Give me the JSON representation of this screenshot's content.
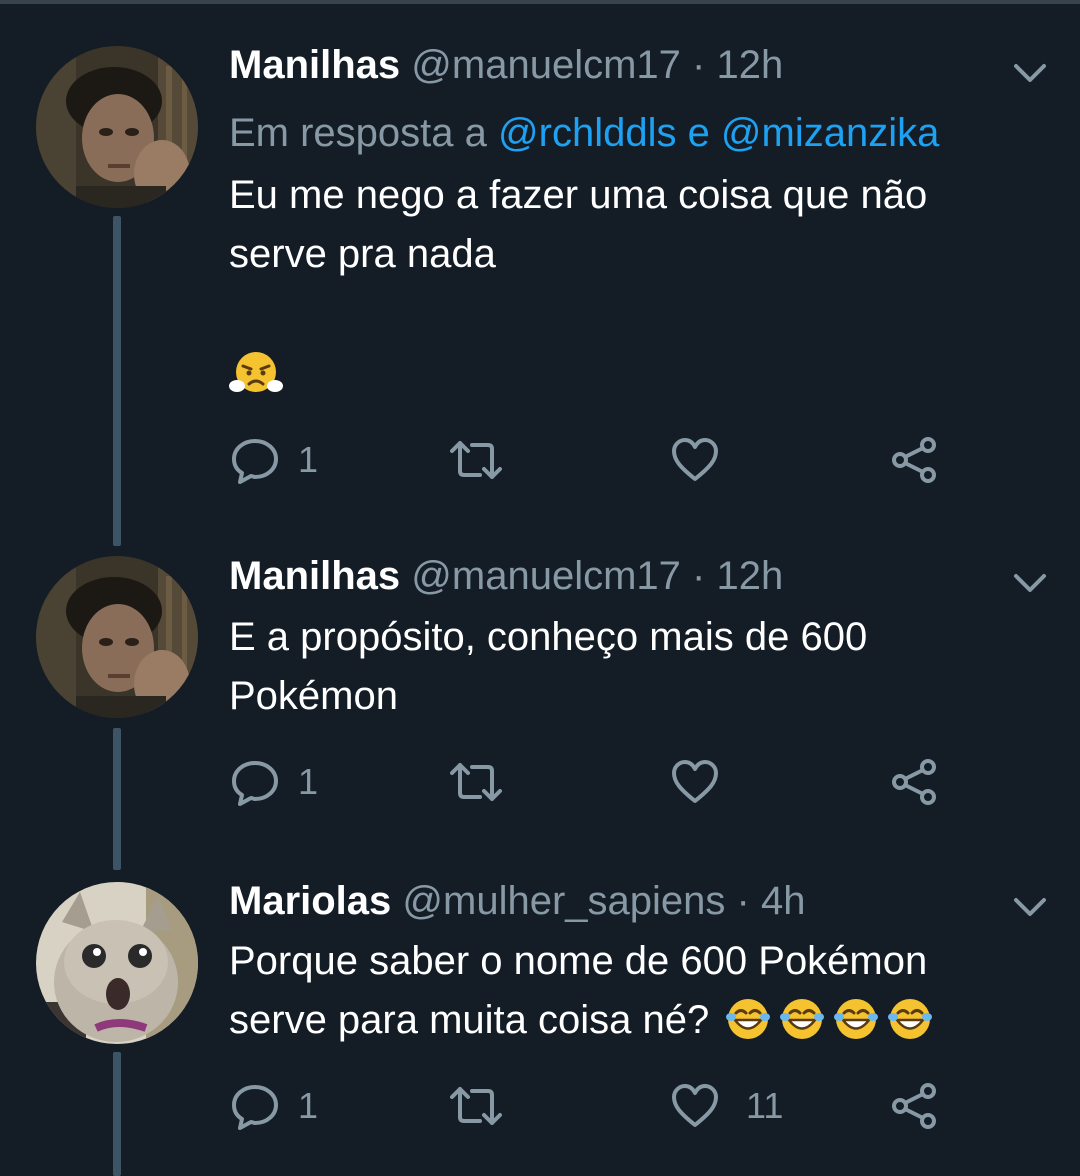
{
  "colors": {
    "background": "#141d26",
    "text_primary": "#ffffff",
    "text_secondary": "#8899a6",
    "mention": "#1da1f2",
    "thread_line": "#3d5466"
  },
  "tweets": [
    {
      "name": "Manilhas",
      "handle": "@manuelcm17",
      "separator": "·",
      "time": "12h",
      "reply_prefix": "Em resposta a",
      "reply_mentions": "@rchlddls e @mizanzika",
      "lines": [
        "Eu me nego a fazer uma coisa que não",
        "serve pra nada"
      ],
      "emoji": "triumph-face-emoji",
      "reply_count": "1",
      "retweet_count": "",
      "like_count": ""
    },
    {
      "name": "Manilhas",
      "handle": "@manuelcm17",
      "separator": "·",
      "time": "12h",
      "lines": [
        "E a propósito, conheço mais de 600",
        "Pokémon"
      ],
      "reply_count": "1",
      "retweet_count": "",
      "like_count": ""
    },
    {
      "name": "Mariolas",
      "handle": "@mulher_sapiens",
      "separator": "·",
      "time": "4h",
      "lines": [
        "Porque saber o nome de 600 Pokémon",
        "serve para muita coisa né?"
      ],
      "trailing_emoji": [
        "tears-of-joy-emoji",
        "tears-of-joy-emoji",
        "tears-of-joy-emoji",
        "tears-of-joy-emoji"
      ],
      "reply_count": "1",
      "retweet_count": "",
      "like_count": "11"
    }
  ],
  "icons": {
    "reply": "reply-icon",
    "retweet": "retweet-icon",
    "like": "heart-icon",
    "share": "share-icon",
    "menu": "chevron-down-icon"
  }
}
